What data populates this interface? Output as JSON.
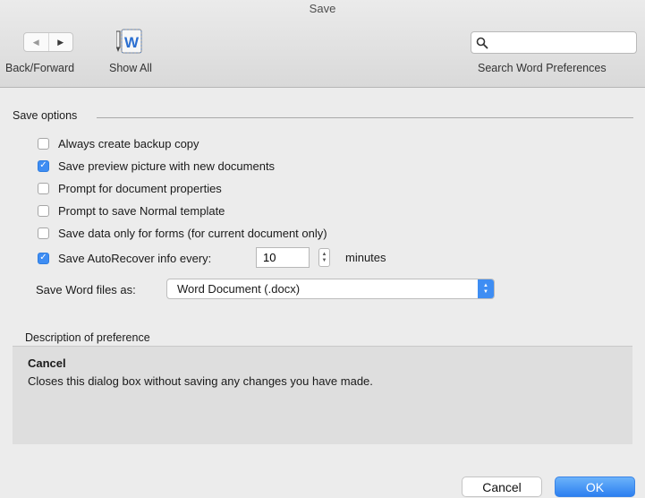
{
  "window": {
    "title": "Save"
  },
  "toolbar": {
    "back_forward_label": "Back/Forward",
    "back_glyph": "◀",
    "forward_glyph": "▶",
    "show_all_label": "Show All",
    "search_label": "Search Word Preferences",
    "search_value": "",
    "search_icon": "magnifier-icon"
  },
  "save_options": {
    "header": "Save options",
    "options": [
      {
        "label": "Always create backup copy",
        "checked": false
      },
      {
        "label": "Save preview picture with new documents",
        "checked": true
      },
      {
        "label": "Prompt for document properties",
        "checked": false
      },
      {
        "label": "Prompt to save Normal template",
        "checked": false
      },
      {
        "label": "Save data only for forms (for current document only)",
        "checked": false
      },
      {
        "label": "Save AutoRecover info every:",
        "checked": true
      }
    ],
    "autorecover_minutes": "10",
    "minutes_label": "minutes",
    "format_label": "Save Word files as:",
    "format_value": "Word Document (.docx)"
  },
  "description": {
    "header": "Description of preference",
    "title": "Cancel",
    "text": "Closes this dialog box without saving any changes you have made."
  },
  "buttons": {
    "cancel": "Cancel",
    "ok": "OK"
  },
  "colors": {
    "accent": "#3e8df3",
    "check_mark": "#ffffff"
  }
}
